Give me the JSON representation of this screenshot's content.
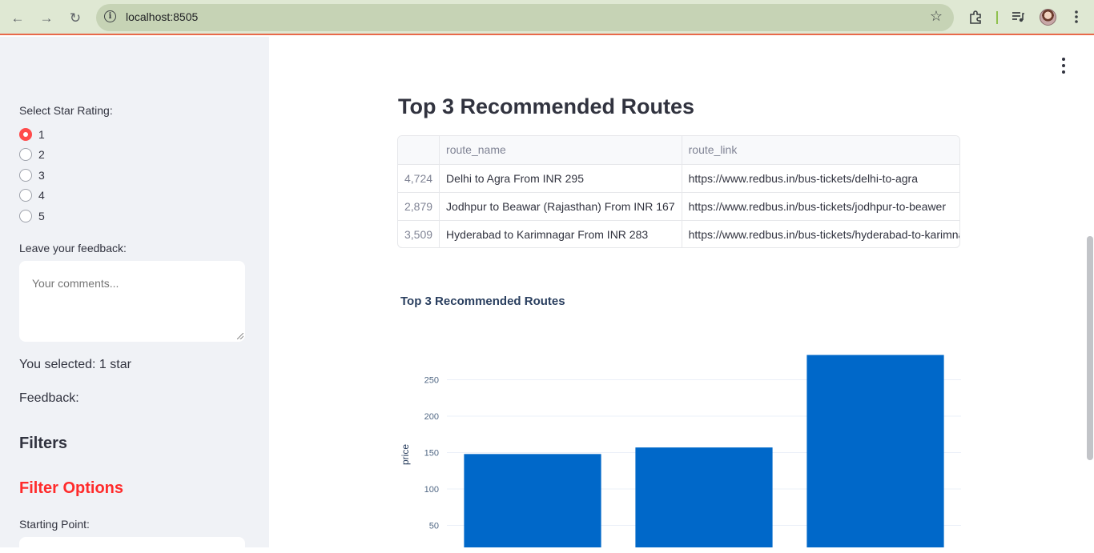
{
  "browser": {
    "url": "localhost:8505"
  },
  "sidebar": {
    "star_rating_label": "Select Star Rating:",
    "rating_options": [
      "1",
      "2",
      "3",
      "4",
      "5"
    ],
    "selected_rating": "1",
    "feedback_label": "Leave your feedback:",
    "feedback_placeholder": "Your comments...",
    "you_selected": "You selected: 1 star",
    "feedback_text": "Feedback:",
    "filters_heading": "Filters",
    "filter_options_heading": "Filter Options",
    "starting_point_label": "Starting Point:"
  },
  "main": {
    "title": "Top 3 Recommended Routes",
    "table": {
      "columns": [
        "",
        "route_name",
        "route_link"
      ],
      "rows": [
        {
          "index": "4,724",
          "route_name": "Delhi to Agra From INR 295",
          "route_link": "https://www.redbus.in/bus-tickets/delhi-to-agra"
        },
        {
          "index": "2,879",
          "route_name": "Jodhpur to Beawar (Rajasthan) From INR 167",
          "route_link": "https://www.redbus.in/bus-tickets/jodhpur-to-beawer"
        },
        {
          "index": "3,509",
          "route_name": "Hyderabad to Karimnagar From INR 283",
          "route_link": "https://www.redbus.in/bus-tickets/hyderabad-to-karimnagar"
        }
      ]
    }
  },
  "chart_data": {
    "type": "bar",
    "title": "Top 3 Recommended Routes",
    "ylabel": "price",
    "yticks": [
      50,
      100,
      150,
      200,
      250
    ],
    "values": [
      148,
      157,
      284
    ],
    "color": "#0068c9",
    "grid": true
  }
}
